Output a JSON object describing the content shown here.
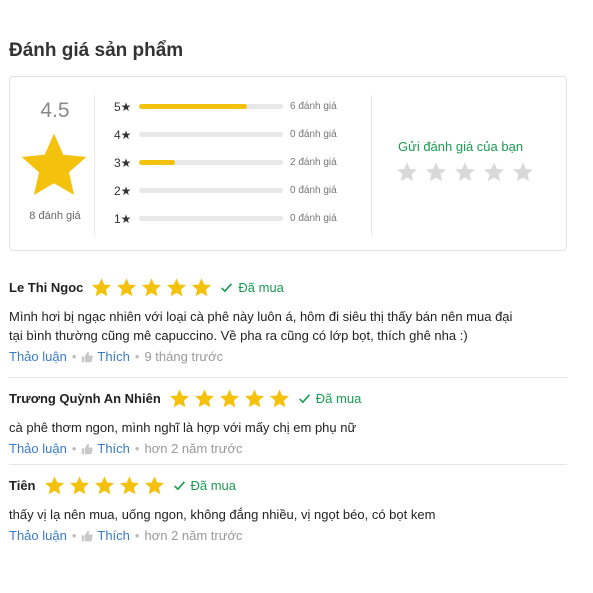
{
  "section_title": "Đánh giá sản phẩm",
  "summary": {
    "average": "4.5",
    "total_label": "8 đánh giá",
    "send_review_label": "Gửi đánh giá của bạn",
    "breakdown": [
      {
        "label": "5★",
        "fraction": 0.75,
        "count": "6 đánh giá"
      },
      {
        "label": "4★",
        "fraction": 0,
        "count": "0 đánh giá"
      },
      {
        "label": "3★",
        "fraction": 0.25,
        "count": "2 đánh giá"
      },
      {
        "label": "2★",
        "fraction": 0,
        "count": "0 đánh giá"
      },
      {
        "label": "1★",
        "fraction": 0,
        "count": "0 đánh giá"
      }
    ]
  },
  "colors": {
    "star": "#f4c20d",
    "empty_star": "#d9d9d9",
    "green": "#1a9c52",
    "link": "#3a7bc8"
  },
  "reviews": [
    {
      "name": "Le Thi Ngoc",
      "rating": 5,
      "verified_label": "Đã mua",
      "text_line1": "Mình hơi bị ngạc nhiên với loại cà phê này luôn á, hôm đi siêu thị thấy bán nên mua đại",
      "text_line2": "tại bình thường cũng mê capuccino. Về pha ra cũng có lớp bọt, thích ghê nha :)",
      "discuss_label": "Thảo luận",
      "like_label": "Thích",
      "time": "9 tháng trước"
    },
    {
      "name": "Trương Quỳnh An Nhiên",
      "rating": 5,
      "verified_label": "Đã mua",
      "text_line1": "cà phê thơm ngon, mình nghĩ là hợp với mấy chị em phụ nữ",
      "discuss_label": "Thảo luận",
      "like_label": "Thích",
      "time": "hơn 2 năm trước"
    },
    {
      "name": "Tiên",
      "rating": 5,
      "verified_label": "Đã mua",
      "text_line1": "thấy vị lạ nên mua, uống ngon, không đắng nhiều, vị ngọt béo, có bọt kem",
      "discuss_label": "Thảo luận",
      "like_label": "Thích",
      "time": "hơn 2 năm trước"
    }
  ]
}
